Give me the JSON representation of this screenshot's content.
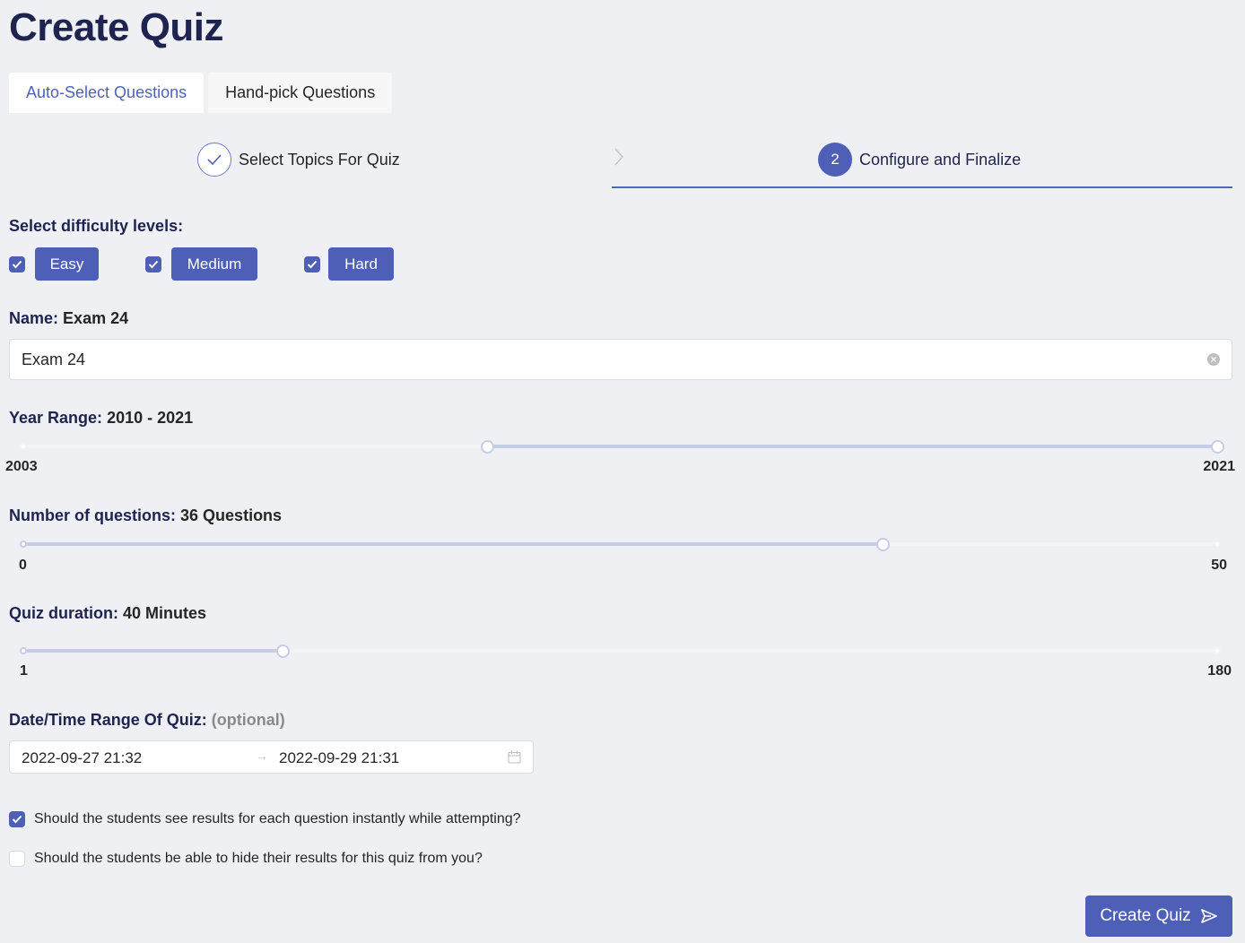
{
  "page": {
    "title": "Create Quiz"
  },
  "tabs": [
    {
      "label": "Auto-Select Questions",
      "active": true
    },
    {
      "label": "Hand-pick Questions",
      "active": false
    }
  ],
  "steps": [
    {
      "label": "Select Topics For Quiz",
      "status": "done",
      "icon": "check-icon"
    },
    {
      "label": "Configure and Finalize",
      "status": "active",
      "number": "2"
    }
  ],
  "difficulty": {
    "label": "Select difficulty levels:",
    "options": [
      {
        "label": "Easy",
        "checked": true
      },
      {
        "label": "Medium",
        "checked": true
      },
      {
        "label": "Hard",
        "checked": true
      }
    ]
  },
  "name": {
    "label": "Name:",
    "label_value": "Exam 24",
    "value": "Exam 24"
  },
  "year_range": {
    "label": "Year Range:",
    "label_value": "2010 - 2021",
    "min": 2003,
    "max": 2021,
    "selected": [
      2010,
      2021
    ],
    "min_label": "2003",
    "max_label": "2021"
  },
  "num_questions": {
    "label": "Number of questions:",
    "label_value": "36 Questions",
    "min": 0,
    "max": 50,
    "value": 36,
    "min_label": "0",
    "max_label": "50"
  },
  "duration": {
    "label": "Quiz duration:",
    "label_value": "40 Minutes",
    "min": 1,
    "max": 180,
    "value": 40,
    "min_label": "1",
    "max_label": "180"
  },
  "date_range": {
    "label": "Date/Time Range Of Quiz:",
    "optional": "(optional)",
    "start": "2022-09-27 21:32",
    "end": "2022-09-29 21:31"
  },
  "options": [
    {
      "label": "Should the students see results for each question instantly while attempting?",
      "checked": true
    },
    {
      "label": "Should the students be able to hide their results for this quiz from you?",
      "checked": false
    }
  ],
  "create_button": {
    "label": "Create Quiz",
    "icon": "send-icon"
  },
  "colors": {
    "primary": "#4e5fb8",
    "heading": "#1f2350",
    "slider_track": "#c5cde6",
    "background": "#eef0f4"
  }
}
